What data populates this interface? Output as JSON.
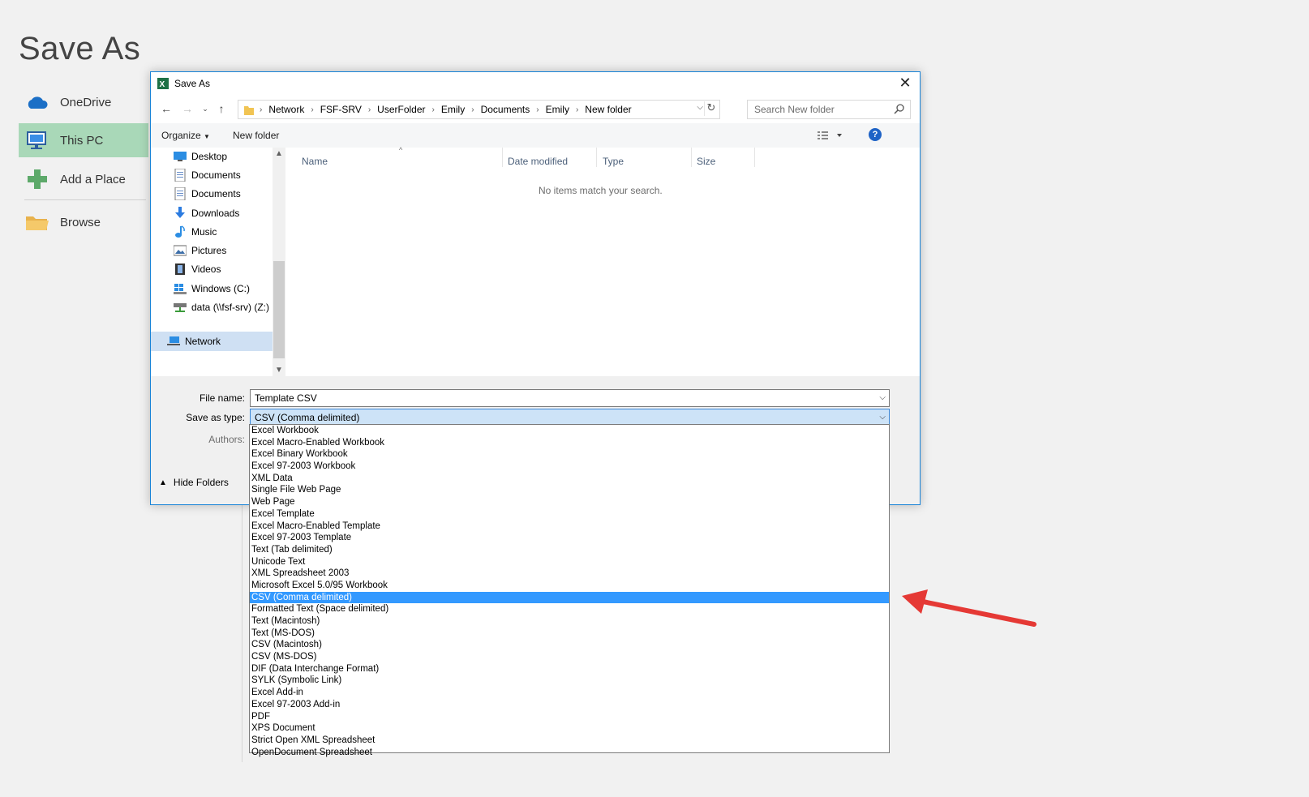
{
  "backstage": {
    "title": "Save As",
    "items": [
      {
        "label": "OneDrive",
        "icon": "cloud-icon"
      },
      {
        "label": "This PC",
        "icon": "monitor-icon"
      },
      {
        "label": "Add a Place",
        "icon": "plus-icon"
      },
      {
        "label": "Browse",
        "icon": "folder-icon"
      }
    ]
  },
  "dialog": {
    "title": "Save As",
    "address": {
      "crumbs": [
        "Network",
        "FSF-SRV",
        "UserFolder",
        "Emily",
        "Documents",
        "Emily",
        "New folder"
      ]
    },
    "search_placeholder": "Search New folder",
    "toolbar": {
      "organize": "Organize",
      "new_folder": "New folder"
    },
    "nav": [
      {
        "label": "Desktop",
        "icon": "desktop-icon"
      },
      {
        "label": "Documents",
        "icon": "document-icon"
      },
      {
        "label": "Documents",
        "icon": "document-icon"
      },
      {
        "label": "Downloads",
        "icon": "download-icon"
      },
      {
        "label": "Music",
        "icon": "music-icon"
      },
      {
        "label": "Pictures",
        "icon": "pictures-icon"
      },
      {
        "label": "Videos",
        "icon": "videos-icon"
      },
      {
        "label": "Windows (C:)",
        "icon": "drive-icon"
      },
      {
        "label": "data (\\\\fsf-srv) (Z:)",
        "icon": "network-drive-icon"
      },
      {
        "label": "Network",
        "icon": "network-icon"
      }
    ],
    "columns": [
      "Name",
      "Date modified",
      "Type",
      "Size"
    ],
    "empty_message": "No items match your search.",
    "file_name_label": "File name:",
    "file_name_value": "Template CSV",
    "save_type_label": "Save as type:",
    "save_type_value": "CSV (Comma delimited)",
    "authors_label": "Authors:",
    "hide_folders": "Hide Folders"
  },
  "file_types": [
    "Excel Workbook",
    "Excel Macro-Enabled Workbook",
    "Excel Binary Workbook",
    "Excel 97-2003 Workbook",
    "XML Data",
    "Single File Web Page",
    "Web Page",
    "Excel Template",
    "Excel Macro-Enabled Template",
    "Excel 97-2003 Template",
    "Text (Tab delimited)",
    "Unicode Text",
    "XML Spreadsheet 2003",
    "Microsoft Excel 5.0/95 Workbook",
    "CSV (Comma delimited)",
    "Formatted Text (Space delimited)",
    "Text (Macintosh)",
    "Text (MS-DOS)",
    "CSV (Macintosh)",
    "CSV (MS-DOS)",
    "DIF (Data Interchange Format)",
    "SYLK (Symbolic Link)",
    "Excel Add-in",
    "Excel 97-2003 Add-in",
    "PDF",
    "XPS Document",
    "Strict Open XML Spreadsheet",
    "OpenDocument Spreadsheet"
  ],
  "selected_file_type_index": 14,
  "colors": {
    "accent": "#1883d7",
    "highlight": "#3399ff",
    "this_pc_bg": "#a9d8b8",
    "arrow": "#e53935"
  }
}
